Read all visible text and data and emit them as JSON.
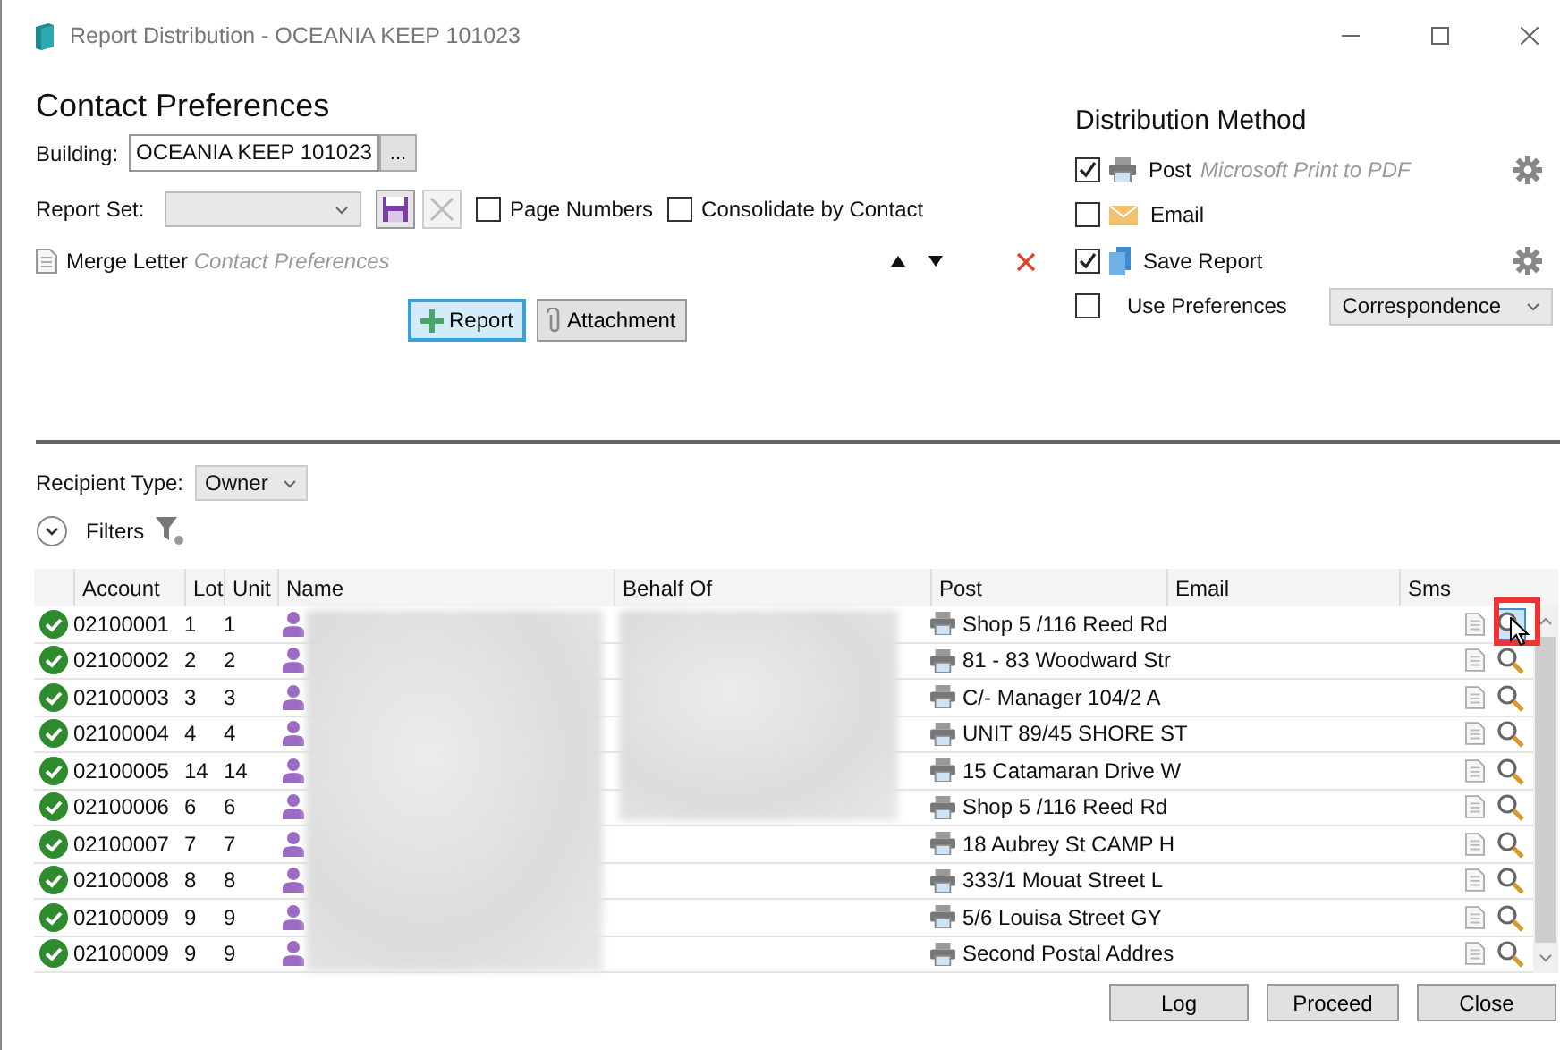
{
  "window": {
    "title": "Report Distribution - OCEANIA KEEP 101023"
  },
  "heading": "Contact Preferences",
  "building": {
    "label": "Building:",
    "value": "OCEANIA KEEP 101023",
    "browse": "..."
  },
  "report_set": {
    "label": "Report Set:",
    "options": [
      {
        "label": "Page Numbers",
        "checked": false
      },
      {
        "label": "Consolidate by Contact",
        "checked": false
      }
    ]
  },
  "reports": [
    {
      "name": "Merge Letter",
      "detail": "Contact Preferences"
    }
  ],
  "add_buttons": [
    {
      "kind": "report",
      "label": "Report",
      "selected": true
    },
    {
      "kind": "attachment",
      "label": "Attachment",
      "selected": false
    }
  ],
  "distribution": {
    "title": "Distribution Method",
    "methods": [
      {
        "kind": "post",
        "label": "Post",
        "detail": "Microsoft Print to PDF",
        "checked": true,
        "settings": true
      },
      {
        "kind": "email",
        "label": "Email",
        "checked": false,
        "settings": false
      },
      {
        "kind": "save",
        "label": "Save Report",
        "checked": true,
        "settings": true
      },
      {
        "kind": "preferences",
        "label": "Use Preferences",
        "checked": false,
        "settings": false,
        "select": "Correspondence"
      }
    ]
  },
  "recipient_type": {
    "label": "Recipient Type:",
    "value": "Owner"
  },
  "filters": {
    "label": "Filters",
    "expanded": false
  },
  "table": {
    "columns": [
      "Account",
      "Lot",
      "Unit",
      "Name",
      "Behalf Of",
      "Post",
      "Email",
      "Sms"
    ],
    "rows": [
      {
        "account": "02100001",
        "lot": "1",
        "unit": "1",
        "post": "Shop 5 /116 Reed Rd",
        "hovered": true
      },
      {
        "account": "02100002",
        "lot": "2",
        "unit": "2",
        "post": "81 - 83 Woodward Str",
        "hovered": false
      },
      {
        "account": "02100003",
        "lot": "3",
        "unit": "3",
        "post": "C/- Manager 104/2 A",
        "hovered": false
      },
      {
        "account": "02100004",
        "lot": "4",
        "unit": "4",
        "post": "UNIT 89/45 SHORE ST",
        "hovered": false
      },
      {
        "account": "02100005",
        "lot": "14",
        "unit": "14",
        "post": "15 Catamaran Drive W",
        "hovered": false
      },
      {
        "account": "02100006",
        "lot": "6",
        "unit": "6",
        "post": "Shop 5 /116 Reed Rd",
        "hovered": false
      },
      {
        "account": "02100007",
        "lot": "7",
        "unit": "7",
        "post": "18 Aubrey St CAMP H",
        "hovered": false
      },
      {
        "account": "02100008",
        "lot": "8",
        "unit": "8",
        "post": "333/1 Mouat Street L",
        "hovered": false
      },
      {
        "account": "02100009",
        "lot": "9",
        "unit": "9",
        "post": "5/6 Louisa Street GY",
        "hovered": false
      },
      {
        "account": "02100009",
        "lot": "9",
        "unit": "9",
        "post": "Second Postal Addres",
        "hovered": false
      }
    ]
  },
  "buttons": [
    "Log",
    "Proceed",
    "Close"
  ]
}
